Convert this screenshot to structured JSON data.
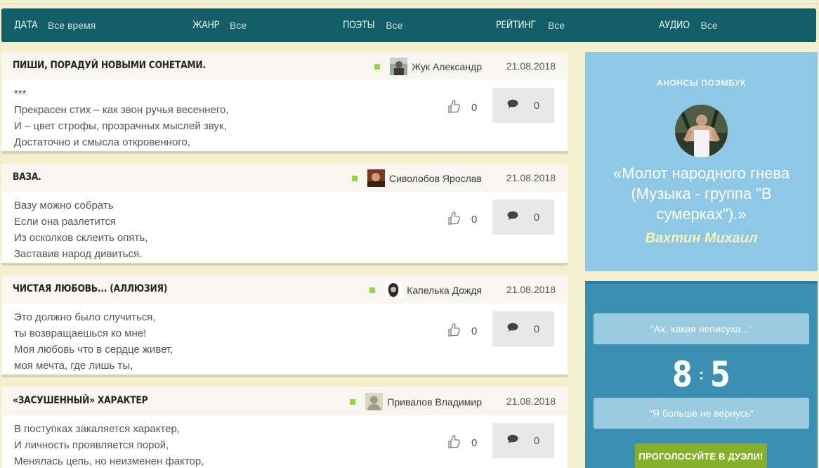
{
  "filters": [
    {
      "label": "ДАТА",
      "value": "Все время"
    },
    {
      "label": "ЖАНР",
      "value": "Все"
    },
    {
      "label": "ПОЭТЫ",
      "value": "Все"
    },
    {
      "label": "РЕЙТИНГ",
      "value": "Все"
    },
    {
      "label": "АУДИО",
      "value": "Все"
    }
  ],
  "posts": [
    {
      "title": "ПИШИ, ПОРАДУЙ НОВЫМИ СОНЕТАМИ.",
      "author": "Жук Александр",
      "date": "21.08.2018",
      "lines": [
        "***",
        "Прекрасен стих – как звон ручья весеннего,",
        "И – цвет строфы, прозрачных мыслей звук,",
        "Достаточно и смысла откровенного,"
      ],
      "likes": "0",
      "comments": "0"
    },
    {
      "title": "ВАЗА.",
      "author": "Сиволобов Ярослав",
      "date": "21.08.2018",
      "lines": [
        "Вазу можно собрать",
        "Если она разлетится",
        "Из осколков склеить опять,",
        "Заставив народ дивиться."
      ],
      "likes": "0",
      "comments": "0"
    },
    {
      "title": "ЧИСТАЯ ЛЮБОВЬ... (АЛЛЮЗИЯ)",
      "author": "Капелька Дождя",
      "date": "21.08.2018",
      "lines": [
        "Это должно было случиться,",
        "ты возвращаешься ко мне!",
        "Моя любовь что в сердце живет,",
        "моя мечта, где лишь ты,"
      ],
      "likes": "0",
      "comments": "0"
    },
    {
      "title": "«ЗАСУШЕННЫЙ» ХАРАКТЕР",
      "author": "Привалов Владимир",
      "date": "21.08.2018",
      "lines": [
        "В поступках закаляется характер,",
        "И личность проявляется порой,",
        "Менялась цепь, но неизменен фактор,"
      ],
      "likes": "0",
      "comments": "0"
    }
  ],
  "announce": {
    "label": "АНОНСЫ ПОЭМБУК",
    "title": "«Молот народного гнева (Музыка - группа \"В сумерках\").»",
    "author": "Вахтин Михаил"
  },
  "duel": {
    "option_a": "\"Ах, какая неписуха...\"",
    "score_a": "8",
    "separator": ":",
    "score_b": "5",
    "option_b": "\"Я больше не вернусь\"",
    "vote_label": "ПРОГОЛОСУЙТЕ В ДУЭЛИ!"
  },
  "colors": {
    "filterbar": "#115e66",
    "announce_bg": "#8ec8e5",
    "duel_bg": "#3b8fb1",
    "vote_btn": "#86b02a",
    "online_dot": "#9bd24b"
  }
}
